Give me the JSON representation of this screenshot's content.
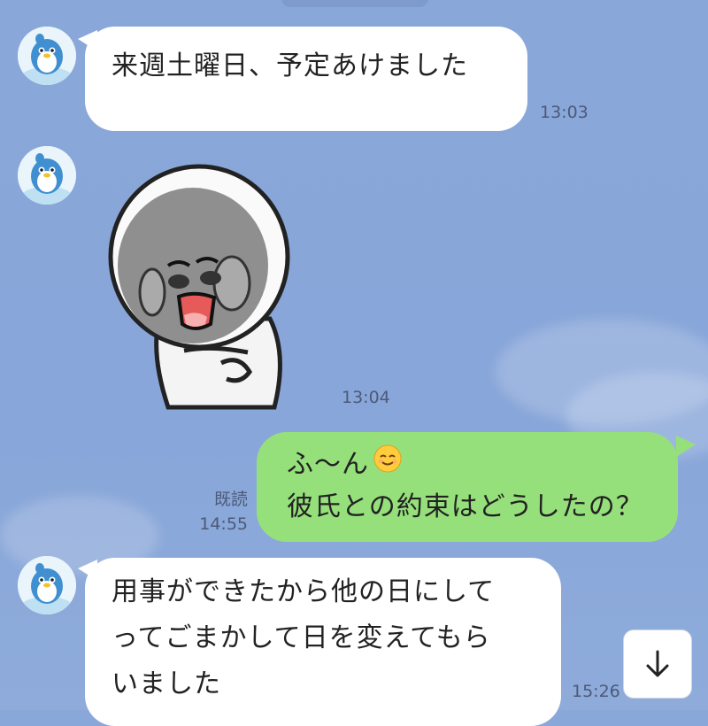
{
  "messages": [
    {
      "side": "left",
      "text": "来週土曜日、予定あけました",
      "time": "13:03"
    },
    {
      "side": "left",
      "sticker": "moon-sticker-sad",
      "time": "13:04"
    },
    {
      "side": "right",
      "line1": "ふ〜ん",
      "emoji": "relieved-face-emoji",
      "line2": "彼氏との約束はどうしたの？",
      "read_label": "既読",
      "time": "14:55"
    },
    {
      "side": "left",
      "line1": "用事ができたから他の日にして",
      "line2": "ってごまかして日を変えてもら",
      "line3": "いました",
      "time": "15:26"
    }
  ],
  "colors": {
    "bg": "#88a6d9",
    "left_bubble": "#ffffff",
    "right_bubble": "#96e07c",
    "time_text": "#4c5a78"
  },
  "icons": {
    "scroll_down": "arrow-down-icon",
    "avatar": "penguin-avatar"
  }
}
